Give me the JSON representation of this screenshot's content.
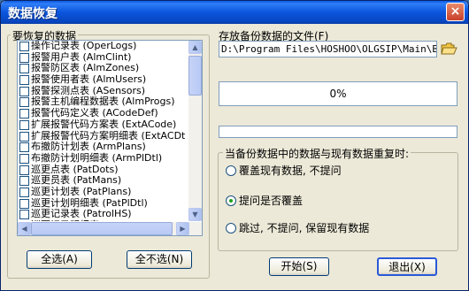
{
  "window": {
    "title": "数据恢复",
    "close_glyph": "×"
  },
  "list": {
    "label": "要恢复的数据",
    "items": [
      "操作记录表 (OperLogs)",
      "报警用户表 (AlmClint)",
      "报警防区表 (AlmZones)",
      "报警使用者表 (AlmUsers)",
      "报警探测点表 (ASensors)",
      "报警主机编程数据表 (AlmProgs)",
      "报警代码定义表 (ACodeDef)",
      "扩展报警代码方案表 (ExtACode)",
      "扩展报警代码方案明细表 (ExtACDt",
      "布撤防计划表 (ArmPlans)",
      "布撤防计划明细表 (ArmPlDtl)",
      "巡更点表 (PatDots)",
      "巡更员表 (PatMans)",
      "巡更计划表 (PatPlans)",
      "巡更计划明细表 (PatPlDtl)",
      "巡更记录表 (PatrolHS)",
      "巡更记录明细表 (PatRHSD)"
    ],
    "select_all_label": "全选(A)",
    "deselect_all_label": "全不选(N)"
  },
  "file": {
    "label": "存放备份数据的文件(F)",
    "path_value": "D:\\Program Files\\HOSHOO\\OLGSIP\\Main\\Backu"
  },
  "progress": {
    "text": "0%",
    "value": 0
  },
  "conflict": {
    "label": "当备份数据中的数据与现有数据重复时:",
    "options": [
      {
        "label": "覆盖现有数据, 不提问",
        "checked": false
      },
      {
        "label": "提问是否覆盖",
        "checked": true
      },
      {
        "label": "跳过, 不提问, 保留现有数据",
        "checked": false
      }
    ]
  },
  "actions": {
    "start_label": "开始(S)",
    "exit_label": "退出(X)"
  },
  "colors": {
    "titlebar": "#0a55dd",
    "face": "#ece9d8",
    "radio_dot": "#21a121"
  },
  "icons": {
    "close": "close-icon",
    "folder": "folder-open-icon",
    "scroll_up": "scroll-up-icon",
    "scroll_down": "scroll-down-icon",
    "scroll_left": "scroll-left-icon",
    "scroll_right": "scroll-right-icon"
  }
}
